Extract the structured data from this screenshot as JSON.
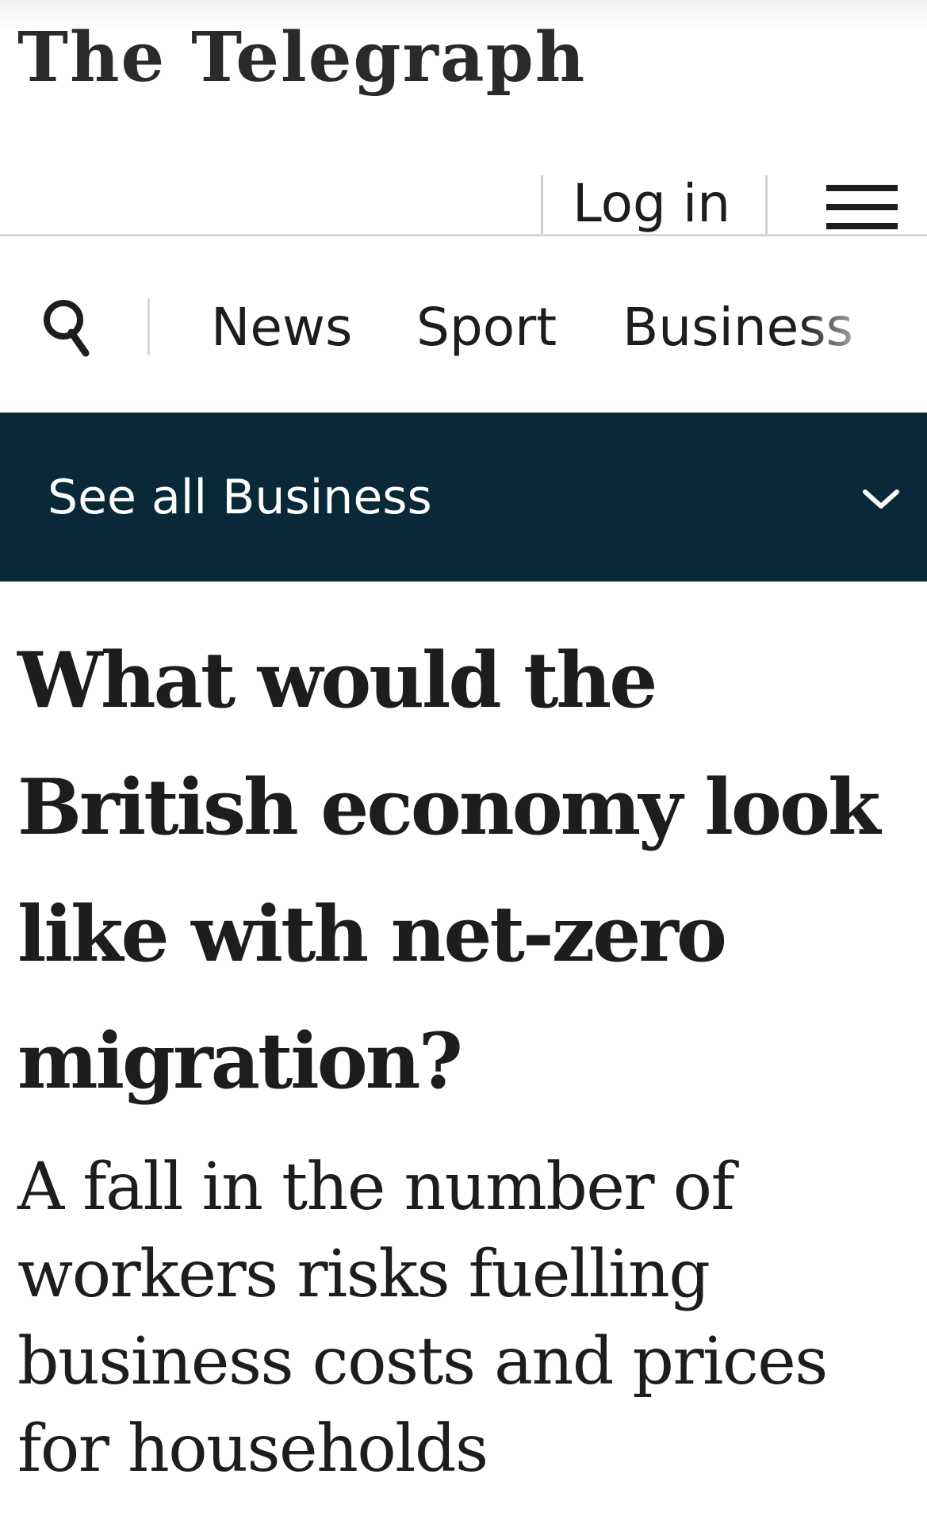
{
  "masthead": {
    "logo_text": "The Telegraph"
  },
  "account": {
    "login_label": "Log in",
    "menu_icon": "hamburger-menu-icon"
  },
  "nav": {
    "search_icon": "search-icon",
    "items": [
      {
        "label": "News"
      },
      {
        "label": "Sport"
      },
      {
        "label": "Business"
      }
    ]
  },
  "section": {
    "label": "See all Business",
    "icon": "chevron-down-icon",
    "background_color": "#0a2938"
  },
  "article": {
    "headline": "What would the British economy look like with net-zero migration?",
    "standfirst": "A fall in the number of workers risks fuelling business costs and prices for households"
  }
}
